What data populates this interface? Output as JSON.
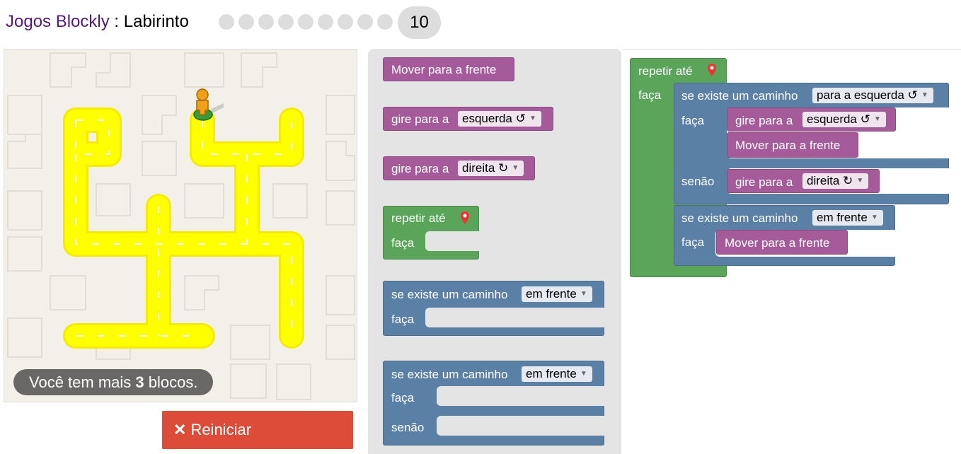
{
  "header": {
    "app_name": "Jogos Blockly",
    "separator": " : ",
    "game_name": "Labirinto",
    "current_level": "10"
  },
  "maze": {
    "capacity_prefix": "Você tem mais ",
    "capacity_count": "3",
    "capacity_suffix": " blocos."
  },
  "reset_button": {
    "icon": "close-icon",
    "label": "Reiniciar"
  },
  "blocks": {
    "move_forward": "Mover para a frente",
    "turn_label": "gire para a",
    "left": "esquerda ↺",
    "right": "direita ↻",
    "repeat_until": "repetir até",
    "do": "faça",
    "if_path": "se existe um caminho",
    "ahead": "em frente",
    "to_left": "para a esquerda ↺",
    "else": "senão",
    "goal_icon": "marker-icon"
  },
  "colors": {
    "movement": "#a55b99",
    "loop": "#5ba55b",
    "logic": "#5b80a5",
    "reset": "#dd4b39",
    "title": "#57187d",
    "path": "#ffff00"
  }
}
